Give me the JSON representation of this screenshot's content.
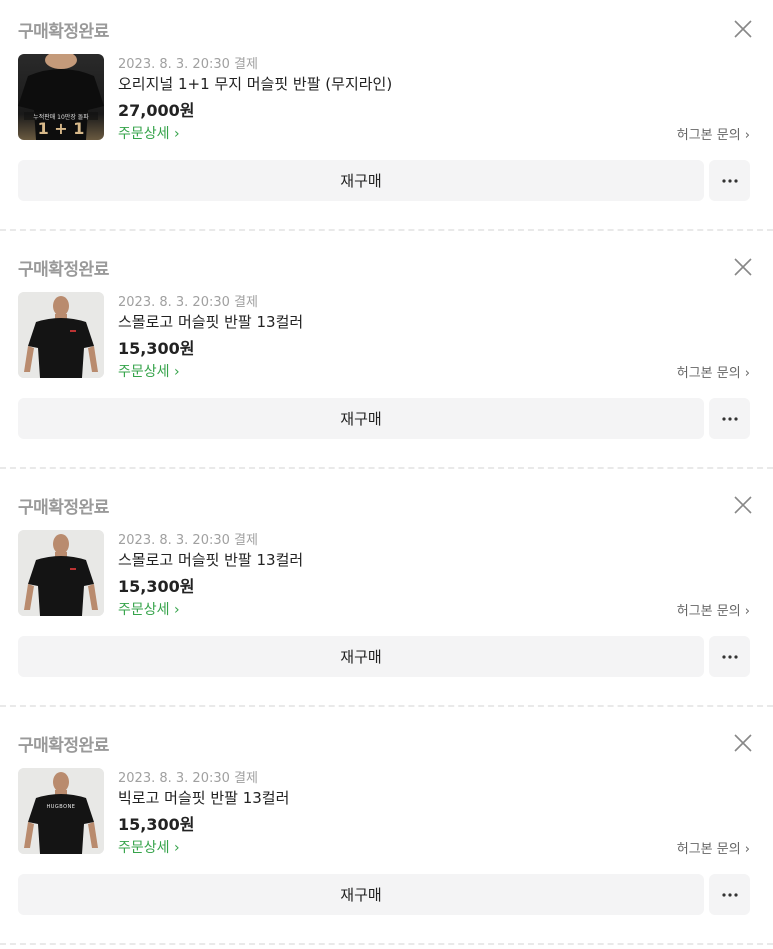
{
  "orders": [
    {
      "status": "구매확정완료",
      "date": "2023. 8. 3. 20:30 결제",
      "title": "오리지널 1+1 무지 머슬핏 반팔 (무지라인)",
      "price": "27,000원",
      "detail_label": "주문상세 ›",
      "inquiry_label": "허그본 문의 ›",
      "rebuy_label": "재구매",
      "thumb_icon": "tshirt-black-1plus1",
      "thumb_text": "1 + 1",
      "thumb_banner": "누적판매 10만장 돌파"
    },
    {
      "status": "구매확정완료",
      "date": "2023. 8. 3. 20:30 결제",
      "title": "스몰로고 머슬핏 반팔 13컬러",
      "price": "15,300원",
      "detail_label": "주문상세 ›",
      "inquiry_label": "허그본 문의 ›",
      "rebuy_label": "재구매",
      "thumb_icon": "model-black-tshirt"
    },
    {
      "status": "구매확정완료",
      "date": "2023. 8. 3. 20:30 결제",
      "title": "스몰로고 머슬핏 반팔 13컬러",
      "price": "15,300원",
      "detail_label": "주문상세 ›",
      "inquiry_label": "허그본 문의 ›",
      "rebuy_label": "재구매",
      "thumb_icon": "model-black-tshirt"
    },
    {
      "status": "구매확정완료",
      "date": "2023. 8. 3. 20:30 결제",
      "title": "빅로고 머슬핏 반팔 13컬러",
      "price": "15,300원",
      "detail_label": "주문상세 ›",
      "inquiry_label": "허그본 문의 ›",
      "rebuy_label": "재구매",
      "thumb_icon": "model-black-tshirt-biglogo",
      "thumb_logo": "HUGBONE"
    }
  ],
  "colors": {
    "accent_green": "#35a34a",
    "status_gray": "#9a9a9a",
    "button_bg": "#f4f4f5"
  }
}
